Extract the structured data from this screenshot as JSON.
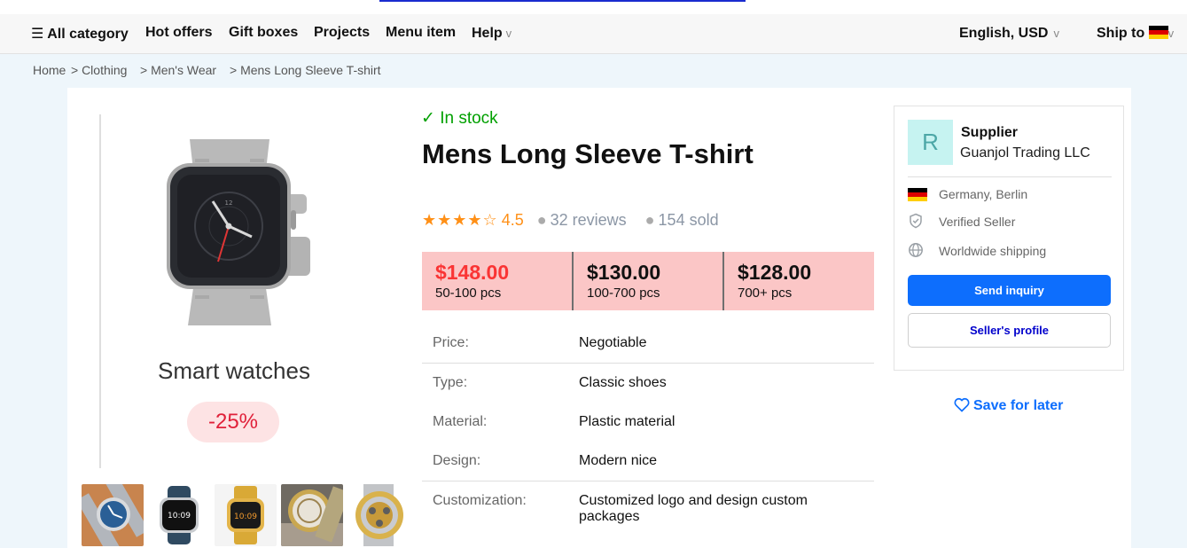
{
  "nav": {
    "menu_icon": "hamburger-icon",
    "all_category": "All category",
    "hot_offers": "Hot offers",
    "gift_boxes": "Gift boxes",
    "projects": "Projects",
    "menu_item": "Menu item",
    "help": "Help",
    "caret": "v",
    "language": "English, USD",
    "ship_to": "Ship to"
  },
  "breadcrumb": {
    "home": "Home",
    "clothing": "> Clothing",
    "mens_wear": "> Men's Wear",
    "current": "> Mens Long Sleeve T-shirt"
  },
  "gallery": {
    "promo_title": "Smart watches",
    "promo_badge": "-25%",
    "thumbnail_count": 5
  },
  "product": {
    "stock_check": "✓",
    "stock": "In stock",
    "title": "Mens Long Sleeve T-shirt",
    "stars": "★★★★☆",
    "rating": "4.5",
    "reviews": "32 reviews",
    "sold": "154 sold"
  },
  "tiers": [
    {
      "price": "$148.00",
      "qty": "50-100 pcs"
    },
    {
      "price": "$130.00",
      "qty": "100-700 pcs"
    },
    {
      "price": "$128.00",
      "qty": "700+ pcs"
    }
  ],
  "specs": {
    "price_label": "Price:",
    "price_value": "Negotiable",
    "type_label": "Type:",
    "type_value": "Classic shoes",
    "material_label": "Material:",
    "material_value": "Plastic material",
    "design_label": "Design:",
    "design_value": "Modern nice",
    "customization_label": "Customization:",
    "customization_value": "Customized logo and design custom packages"
  },
  "supplier": {
    "avatar_letter": "R",
    "heading": "Supplier",
    "name": "Guanjol Trading LLC",
    "location": "Germany, Berlin",
    "verified": "Verified Seller",
    "shipping": "Worldwide shipping",
    "send_inquiry": "Send inquiry",
    "seller_profile": "Seller's profile"
  },
  "save_for_later": "Save for later",
  "colors": {
    "accent_blue": "#0d6efd",
    "in_stock_green": "#00a000",
    "price_red": "#fa3434",
    "rating_orange": "#ff9017",
    "tier_background": "#fbc6c6"
  }
}
